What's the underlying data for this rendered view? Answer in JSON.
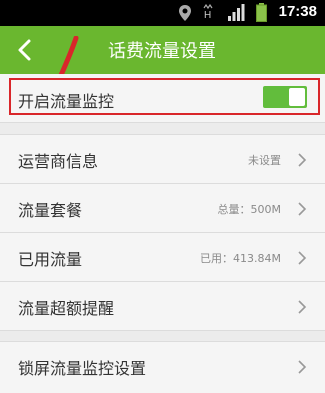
{
  "status_bar": {
    "time": "17:38",
    "icons": [
      "location-icon",
      "vibrate-icon",
      "hspa-icon",
      "signal-icon",
      "battery-icon"
    ],
    "network_label": "H"
  },
  "header": {
    "title": "话费流量设置",
    "back_icon": "chevron-left-icon",
    "bg_color": "#6ab72f"
  },
  "monitor_row": {
    "label": "开启流量监控",
    "toggle_on": true,
    "toggle_color": "#62bd3c"
  },
  "settings": [
    {
      "label": "运营商信息",
      "value": "未设置"
    },
    {
      "label": "流量套餐",
      "value": "总量：500M"
    },
    {
      "label": "已用流量",
      "value": "已用：413.84M"
    },
    {
      "label": "流量超额提醒",
      "value": ""
    }
  ],
  "lock_row": {
    "label": "锁屏流量监控设置"
  },
  "annotation": {
    "color": "#d9262a"
  }
}
